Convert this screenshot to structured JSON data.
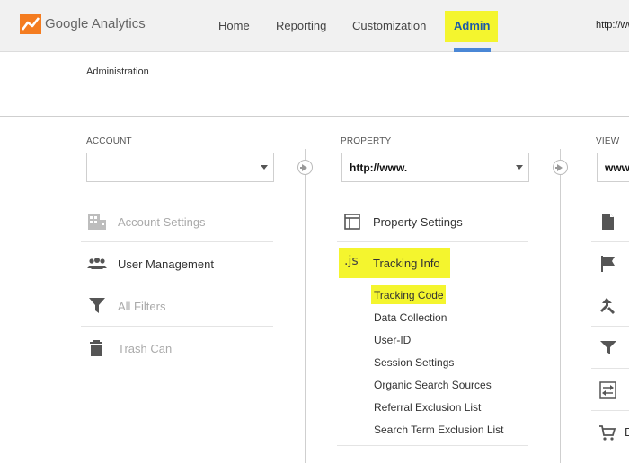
{
  "app": {
    "brand": "Google Analytics"
  },
  "nav": {
    "items": [
      "Home",
      "Reporting",
      "Customization",
      "Admin"
    ],
    "active": "Admin",
    "url_fragment": "http://ww"
  },
  "page": {
    "title": "Administration"
  },
  "account": {
    "label": "ACCOUNT",
    "selected": "",
    "menu": [
      {
        "label": "Account Settings",
        "icon": "building-icon",
        "enabled": false
      },
      {
        "label": "User Management",
        "icon": "users-icon",
        "enabled": true
      },
      {
        "label": "All Filters",
        "icon": "filter-icon",
        "enabled": false
      },
      {
        "label": "Trash Can",
        "icon": "trash-icon",
        "enabled": false
      }
    ]
  },
  "property": {
    "label": "PROPERTY",
    "selected": "http://www.",
    "menu": [
      {
        "label": "Property Settings",
        "icon": "layout-icon"
      },
      {
        "label": "Tracking Info",
        "icon": "js-icon",
        "highlighted": true
      }
    ],
    "js_glyph": ".js",
    "tracking_submenu": [
      "Tracking Code",
      "Data Collection",
      "User-ID",
      "Session Settings",
      "Organic Search Sources",
      "Referral Exclusion List",
      "Search Term Exclusion List"
    ],
    "active_subitem": "Tracking Code"
  },
  "view": {
    "label": "VIEW",
    "selected": "www",
    "icons": [
      "document-icon",
      "flag-icon",
      "merge-icon",
      "filter-icon",
      "transfer-icon",
      "cart-icon"
    ],
    "partial_text": "E"
  },
  "colors": {
    "highlight": "#f4f52e",
    "admin_text": "#1a59a8",
    "underline": "#4a87d6"
  }
}
